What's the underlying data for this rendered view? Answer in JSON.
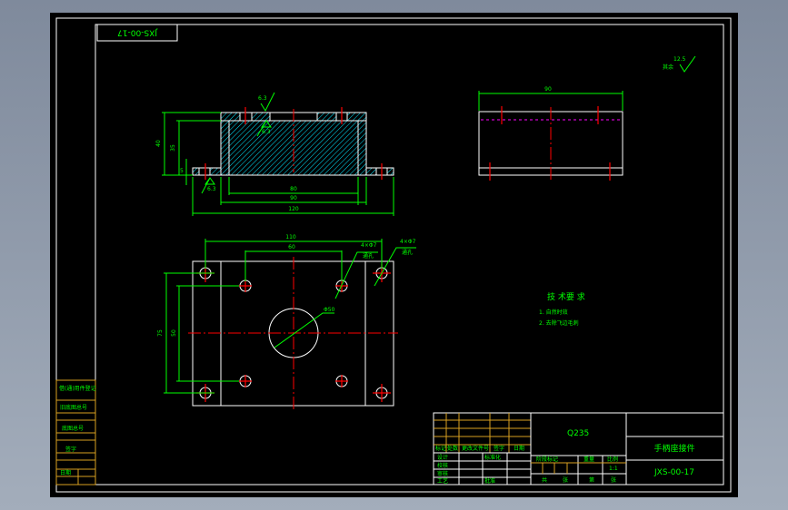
{
  "drawing_number": "JXS-00-17",
  "roughness": {
    "label": "其余",
    "value": "12.5"
  },
  "front_view": {
    "dims": {
      "height_total": "40",
      "height_inner": "35",
      "flange": "5",
      "inner_width": "80",
      "outer_width": "90",
      "total_width": "120"
    },
    "roughness_marks": [
      "6.3",
      "6.3",
      "6.3"
    ]
  },
  "side_view": {
    "dims": {
      "width": "90"
    }
  },
  "top_view": {
    "dims": {
      "hole_span_outer": "110",
      "hole_span_inner": "60",
      "height_outer": "75",
      "height_inner": "50",
      "center_hole": "Φ50"
    },
    "hole_callouts": [
      {
        "qty": "4×Φ7",
        "depth": "通孔"
      },
      {
        "qty": "4×Φ7",
        "depth": "通孔"
      }
    ]
  },
  "tech_requirements": {
    "title": "技 术要 求",
    "items": [
      "1. 自然时效",
      "2. 去除飞边毛刺"
    ]
  },
  "title_block": {
    "material": "Q235",
    "part_name": "手柄座接件",
    "code": "JXS-00-17",
    "rev_headers": [
      "标记",
      "处数",
      "更改文件号",
      "签字",
      "日期"
    ],
    "roles": [
      "设计",
      "校核",
      "审核",
      "工艺"
    ],
    "std": "标准化",
    "approve": "批准",
    "stage_headers": [
      "阶段标记",
      "重量",
      "比例"
    ],
    "sheet": [
      "共",
      "张",
      "第",
      "张"
    ],
    "scale": "1:1"
  },
  "margin_block": [
    "借(通)用件登记",
    "旧底图总号",
    "底图总号",
    "签字",
    "日期"
  ],
  "colors": {
    "background": "#000000",
    "outline": "#ffffff",
    "dimension": "#00ff00",
    "centerline": "#ff0000",
    "hidden": "#ff00ff",
    "table": "#d9a021"
  }
}
